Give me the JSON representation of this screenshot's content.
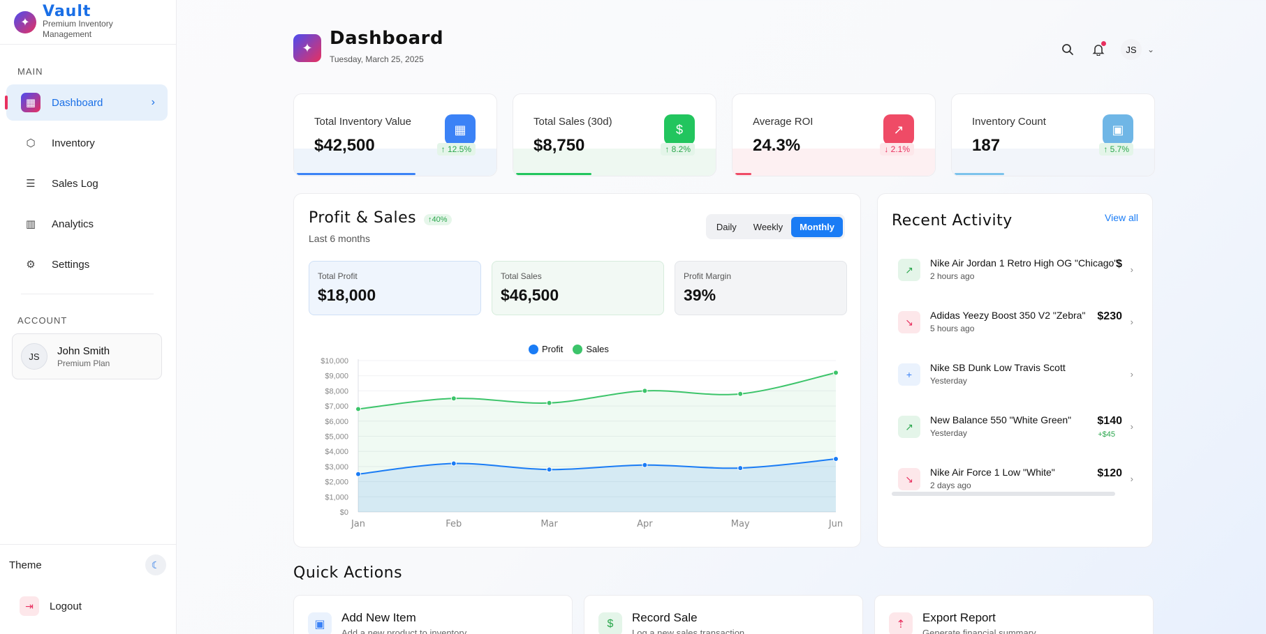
{
  "app": {
    "name": "Vault",
    "tagline": "Premium Inventory Management"
  },
  "sidebar": {
    "main_label": "MAIN",
    "items": [
      {
        "label": "Dashboard",
        "icon": "grid-icon",
        "active": true
      },
      {
        "label": "Inventory",
        "icon": "box-icon"
      },
      {
        "label": "Sales Log",
        "icon": "list-check-icon"
      },
      {
        "label": "Analytics",
        "icon": "bar-chart-icon"
      },
      {
        "label": "Settings",
        "icon": "gear-icon"
      }
    ],
    "account_label": "ACCOUNT",
    "user": {
      "initials": "JS",
      "name": "John Smith",
      "plan": "Premium Plan"
    },
    "theme_label": "Theme",
    "logout_label": "Logout"
  },
  "header": {
    "title": "Dashboard",
    "date": "Tuesday, March 25, 2025",
    "user_initials": "JS"
  },
  "stats": [
    {
      "label": "Total Inventory Value",
      "value": "$42,500",
      "change": "↑ 12.5%",
      "trend": "up",
      "progress": 0.6,
      "color": "#3b82f6",
      "band": "#eef4fb"
    },
    {
      "label": "Total Sales (30d)",
      "value": "$8,750",
      "change": "↑ 8.2%",
      "trend": "up",
      "progress": 0.38,
      "color": "#22c55e",
      "band": "#eef8f1"
    },
    {
      "label": "Average ROI",
      "value": "24.3%",
      "change": "↓ 2.1%",
      "trend": "down",
      "progress": 0.08,
      "color": "#ef4b66",
      "band": "#fdf0f2"
    },
    {
      "label": "Inventory Count",
      "value": "187",
      "change": "↑ 5.7%",
      "trend": "up",
      "progress": 0.25,
      "color": "#7cc3ec",
      "band": "#f2f5fa"
    }
  ],
  "profit_panel": {
    "title": "Profit & Sales",
    "growth": "↑40%",
    "subtitle": "Last 6 months",
    "tabs": [
      "Daily",
      "Weekly",
      "Monthly"
    ],
    "active_tab": "Monthly",
    "summaries": [
      {
        "label": "Total Profit",
        "value": "$18,000"
      },
      {
        "label": "Total Sales",
        "value": "$46,500"
      },
      {
        "label": "Profit Margin",
        "value": "39%"
      }
    ]
  },
  "chart_data": {
    "type": "area",
    "categories": [
      "Jan",
      "Feb",
      "Mar",
      "Apr",
      "May",
      "Jun"
    ],
    "series": [
      {
        "name": "Profit",
        "values": [
          2500,
          3200,
          2800,
          3100,
          2900,
          3500
        ],
        "color": "#1a7cf5"
      },
      {
        "name": "Sales",
        "values": [
          6800,
          7500,
          7200,
          8000,
          7800,
          9200
        ],
        "color": "#3cc46a"
      }
    ],
    "y_ticks": [
      "$0",
      "$1,000",
      "$2,000",
      "$3,000",
      "$4,000",
      "$5,000",
      "$6,000",
      "$7,000",
      "$8,000",
      "$9,000",
      "$10,000"
    ],
    "ylim": [
      0,
      10000
    ],
    "legend": "top-center"
  },
  "activity": {
    "title": "Recent Activity",
    "view_all": "View all",
    "items": [
      {
        "name": "Nike Air Jordan 1 Retro High OG \"Chicago\"",
        "time": "2 hours ago",
        "price": "$",
        "delta": "",
        "kind": "sale"
      },
      {
        "name": "Adidas Yeezy Boost 350 V2 \"Zebra\"",
        "time": "5 hours ago",
        "price": "$230",
        "delta": "",
        "kind": "purchase"
      },
      {
        "name": "Nike SB Dunk Low Travis Scott",
        "time": "Yesterday",
        "price": "",
        "delta": "",
        "kind": "add"
      },
      {
        "name": "New Balance 550 \"White Green\"",
        "time": "Yesterday",
        "price": "$140",
        "delta": "+$45",
        "kind": "sale"
      },
      {
        "name": "Nike Air Force 1 Low \"White\"",
        "time": "2 days ago",
        "price": "$120",
        "delta": "",
        "kind": "purchase"
      }
    ]
  },
  "quick_actions": {
    "title": "Quick Actions",
    "items": [
      {
        "label": "Add New Item",
        "desc": "Add a new product to inventory",
        "icon": "shopping-bag-icon"
      },
      {
        "label": "Record Sale",
        "desc": "Log a new sales transaction",
        "icon": "dollar-icon"
      },
      {
        "label": "Export Report",
        "desc": "Generate financial summary",
        "icon": "upload-icon"
      }
    ]
  }
}
